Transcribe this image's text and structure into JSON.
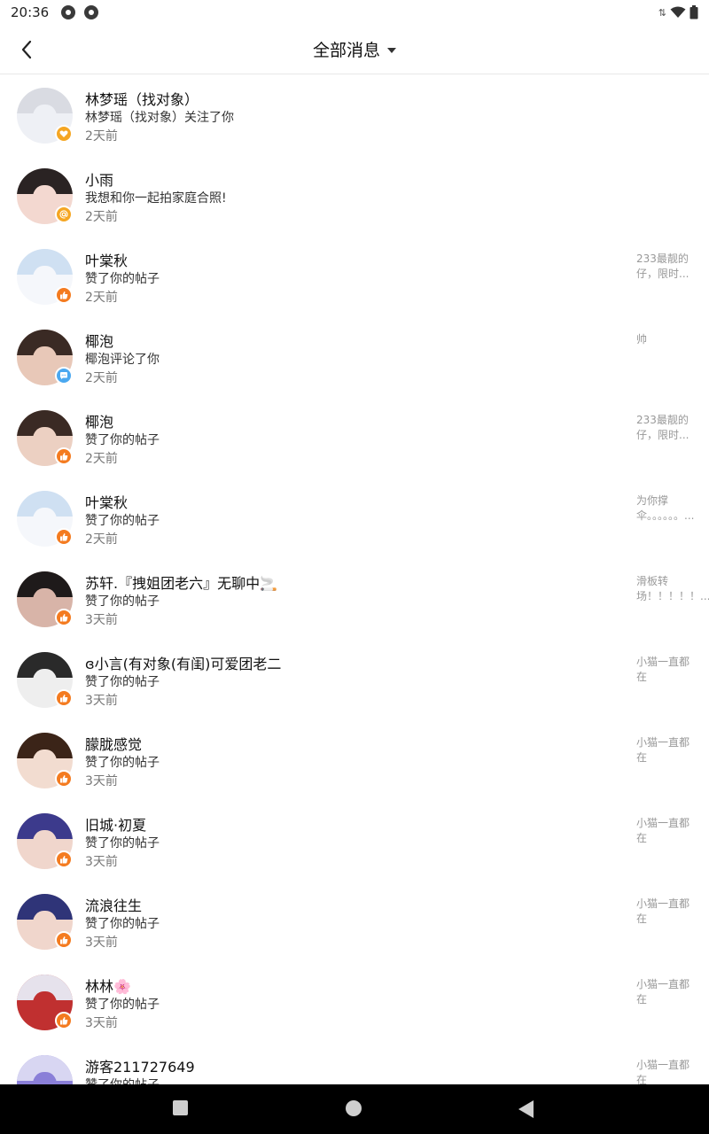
{
  "status_bar": {
    "time": "20:36"
  },
  "header": {
    "title": "全部消息"
  },
  "items": [
    {
      "name": "林梦瑶（找对象）",
      "action": "林梦瑶（找对象）关注了你",
      "time": "2天前",
      "preview": "",
      "badge": "follow",
      "badge_color": "#f5a623",
      "avatar_colors": [
        "#d9dbe2",
        "#eef0f5"
      ]
    },
    {
      "name": "小雨",
      "action": "我想和你一起拍家庭合照!",
      "time": "2天前",
      "preview": "",
      "badge": "mention",
      "badge_color": "#f5a623",
      "avatar_colors": [
        "#2a2323",
        "#f3d8d0"
      ]
    },
    {
      "name": "叶棠秋",
      "action": "赞了你的帖子",
      "time": "2天前",
      "preview": "233最靓的仔，限时...",
      "badge": "like",
      "badge_color": "#f47b20",
      "avatar_colors": [
        "#cfe0f2",
        "#f5f7fb"
      ]
    },
    {
      "name": "椰泡",
      "action": "椰泡评论了你",
      "time": "2天前",
      "preview": "帅",
      "badge": "comment",
      "badge_color": "#4aa8f0",
      "avatar_colors": [
        "#3a2a24",
        "#e8c8b8"
      ]
    },
    {
      "name": "椰泡",
      "action": "赞了你的帖子",
      "time": "2天前",
      "preview": "233最靓的仔，限时...",
      "badge": "like",
      "badge_color": "#f47b20",
      "avatar_colors": [
        "#3a2a24",
        "#ecd0c2"
      ]
    },
    {
      "name": "叶棠秋",
      "action": "赞了你的帖子",
      "time": "2天前",
      "preview": "为你撑伞。。。。。。...",
      "badge": "like",
      "badge_color": "#f47b20",
      "avatar_colors": [
        "#cfe0f2",
        "#f5f7fb"
      ]
    },
    {
      "name": "苏轩.『拽姐团老六』无聊中🚬",
      "action": "赞了你的帖子",
      "time": "3天前",
      "preview": "滑板转场！！！！！...",
      "badge": "like",
      "badge_color": "#f47b20",
      "avatar_colors": [
        "#1e1a1a",
        "#d8b4a8"
      ]
    },
    {
      "name": "ɞ小言(有对象(有闺)可爱团老二",
      "action": "赞了你的帖子",
      "time": "3天前",
      "preview": "小猫一直都在",
      "badge": "like",
      "badge_color": "#f47b20",
      "avatar_colors": [
        "#2a2a2a",
        "#eeeeee"
      ]
    },
    {
      "name": "朦胧感觉",
      "action": "赞了你的帖子",
      "time": "3天前",
      "preview": "小猫一直都在",
      "badge": "like",
      "badge_color": "#f47b20",
      "avatar_colors": [
        "#3b2418",
        "#f2dcd0"
      ]
    },
    {
      "name": "旧城·初夏",
      "action": "赞了你的帖子",
      "time": "3天前",
      "preview": "小猫一直都在",
      "badge": "like",
      "badge_color": "#f47b20",
      "avatar_colors": [
        "#3c3a8c",
        "#f0d6cc"
      ]
    },
    {
      "name": "流浪往生",
      "action": "赞了你的帖子",
      "time": "3天前",
      "preview": "小猫一直都在",
      "badge": "like",
      "badge_color": "#f47b20",
      "avatar_colors": [
        "#2f3478",
        "#f0d6cc"
      ]
    },
    {
      "name": "林林🌸",
      "action": "赞了你的帖子",
      "time": "3天前",
      "preview": "小猫一直都在",
      "badge": "like",
      "badge_color": "#f47b20",
      "avatar_colors": [
        "#e6e2ec",
        "#c03030"
      ]
    },
    {
      "name": "游客211727649",
      "action": "赞了你的帖子",
      "time": "",
      "preview": "小猫一直都在",
      "badge": "like",
      "badge_color": "#f47b20",
      "avatar_colors": [
        "#d8d6f2",
        "#8a7fd8"
      ]
    }
  ]
}
